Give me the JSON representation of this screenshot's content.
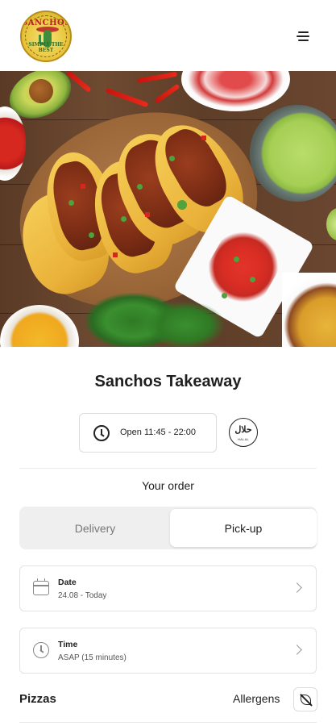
{
  "header": {
    "logo": {
      "top_text": "SANCHOS",
      "bottom_text": "SIMPLY THE BEST"
    },
    "menu_icon": "hamburger-menu-icon"
  },
  "restaurant": {
    "name": "Sanchos Takeaway",
    "hours_label": "Open 11:45 - 22:00",
    "halal_badge": {
      "script": "حلال",
      "text": "HALAL"
    }
  },
  "order": {
    "heading": "Your order",
    "modes": [
      "Delivery",
      "Pick-up"
    ],
    "selected_mode": "Pick-up",
    "date": {
      "label": "Date",
      "value": "24.08 - Today"
    },
    "time": {
      "label": "Time",
      "value": "ASAP (15 minutes)"
    }
  },
  "menu": {
    "category": "Pizzas",
    "allergens_label": "Allergens"
  },
  "colors": {
    "accent_text": "#1f1f1f",
    "toggle_bg": "#efefef"
  }
}
